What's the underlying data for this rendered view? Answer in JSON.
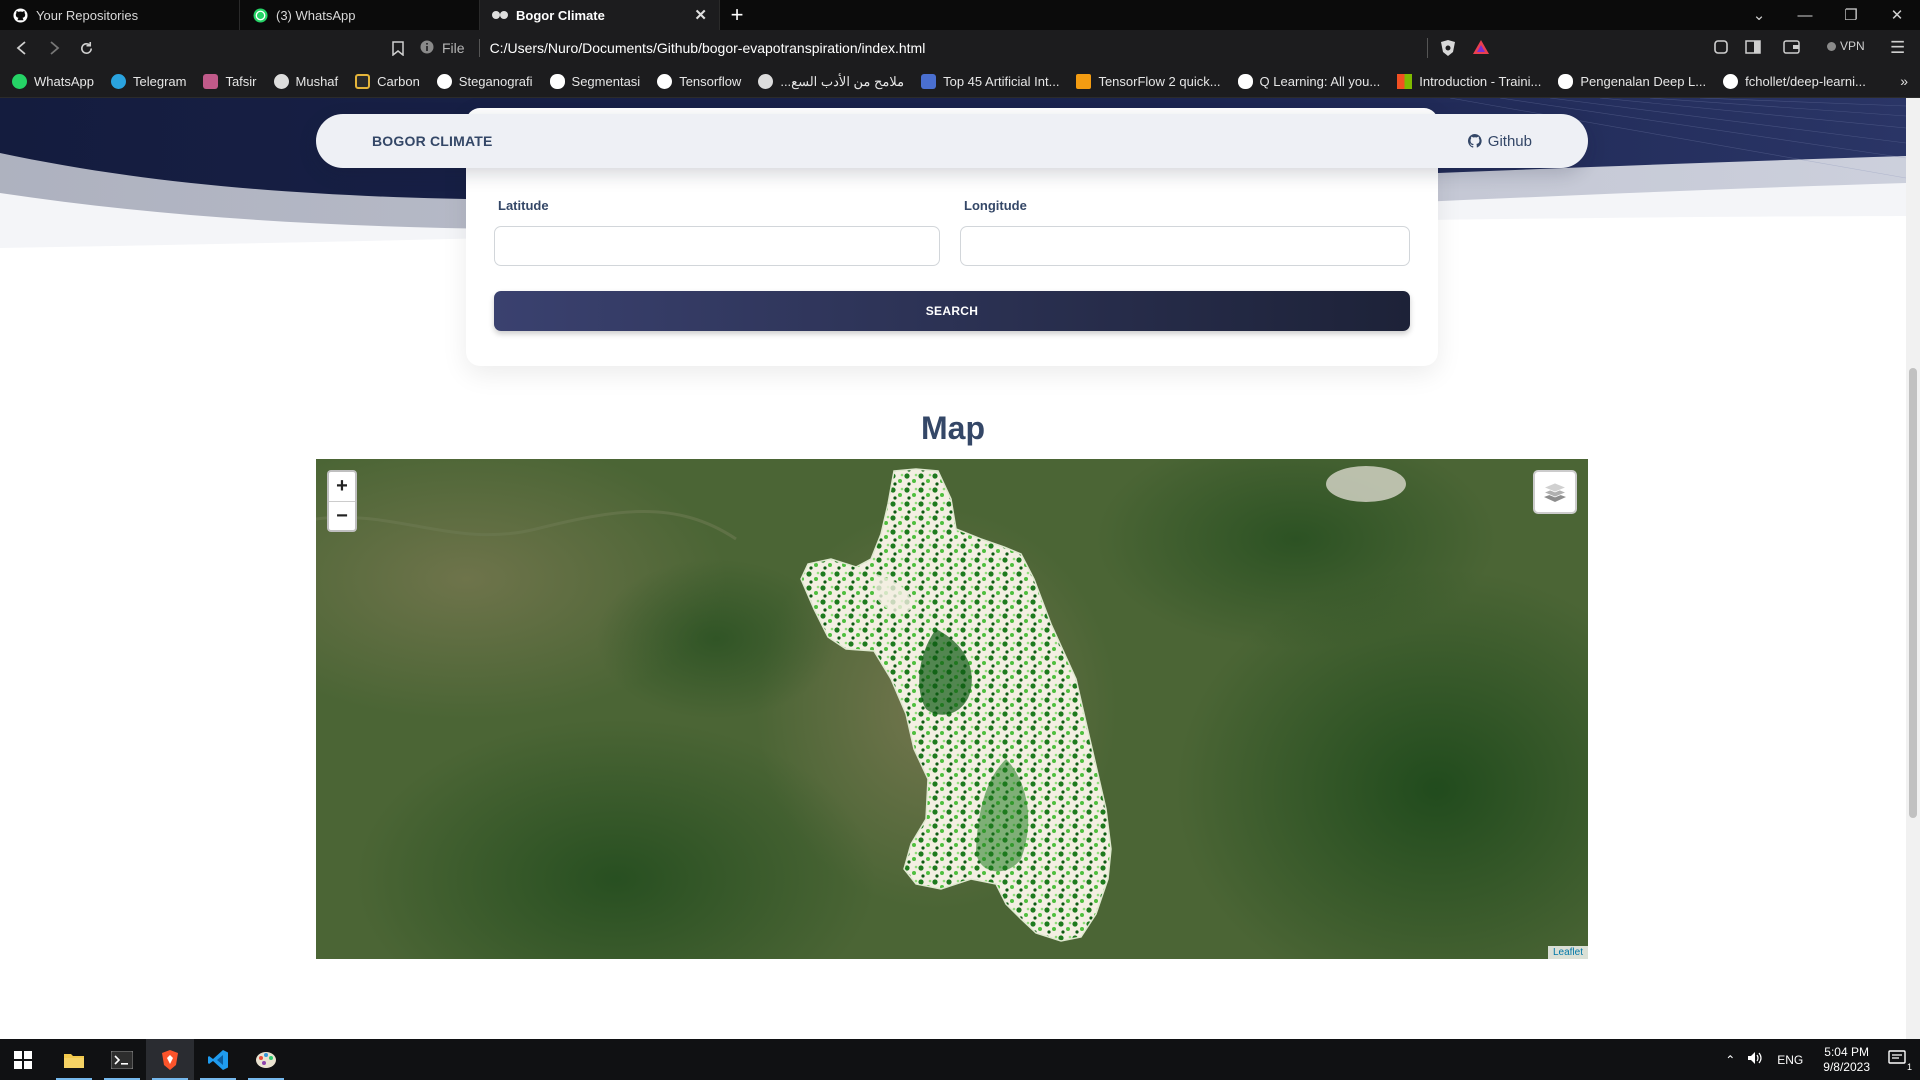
{
  "browser": {
    "tabs": [
      {
        "label": "Your Repositories",
        "icon": "github-icon",
        "active": false
      },
      {
        "label": "(3) WhatsApp",
        "icon": "whatsapp-icon",
        "active": false
      },
      {
        "label": "Bogor Climate",
        "icon": "page-icon",
        "active": true
      }
    ],
    "url_scheme_label": "File",
    "url": "C:/Users/Nuro/Documents/Github/bogor-evapotranspiration/index.html",
    "vpn_label": "VPN",
    "bookmarks": [
      {
        "label": "WhatsApp",
        "color": "#25d366"
      },
      {
        "label": "Telegram",
        "color": "#2aa3df"
      },
      {
        "label": "Tafsir",
        "color": "#c05a8a"
      },
      {
        "label": "Mushaf",
        "color": "#dddddd"
      },
      {
        "label": "Carbon",
        "color": "#e4b43a"
      },
      {
        "label": "Steganografi",
        "color": "#ffffff"
      },
      {
        "label": "Segmentasi",
        "color": "#ffffff"
      },
      {
        "label": "Tensorflow",
        "color": "#ffffff"
      },
      {
        "label": "...ملامح من الأدب السع",
        "color": "#dddddd"
      },
      {
        "label": "Top 45 Artificial Int...",
        "color": "#4a6fd0"
      },
      {
        "label": "TensorFlow 2 quick...",
        "color": "#f39c12"
      },
      {
        "label": "Q Learning: All you...",
        "color": "#ffffff"
      },
      {
        "label": "Introduction - Traini...",
        "color": "#f25022"
      },
      {
        "label": "Pengenalan Deep L...",
        "color": "#ffffff"
      },
      {
        "label": "fchollet/deep-learni...",
        "color": "#ffffff"
      }
    ]
  },
  "site": {
    "brand": "BOGOR CLIMATE",
    "github_label": "Github",
    "form": {
      "latitude_label": "Latitude",
      "latitude_value": "",
      "longitude_label": "Longitude",
      "longitude_value": "",
      "search_label": "SEARCH"
    },
    "map": {
      "title": "Map",
      "zoom_in": "+",
      "zoom_out": "−",
      "attribution": "Leaflet"
    }
  },
  "taskbar": {
    "language": "ENG",
    "time": "5:04 PM",
    "date": "9/8/2023",
    "notification_count": "1"
  }
}
